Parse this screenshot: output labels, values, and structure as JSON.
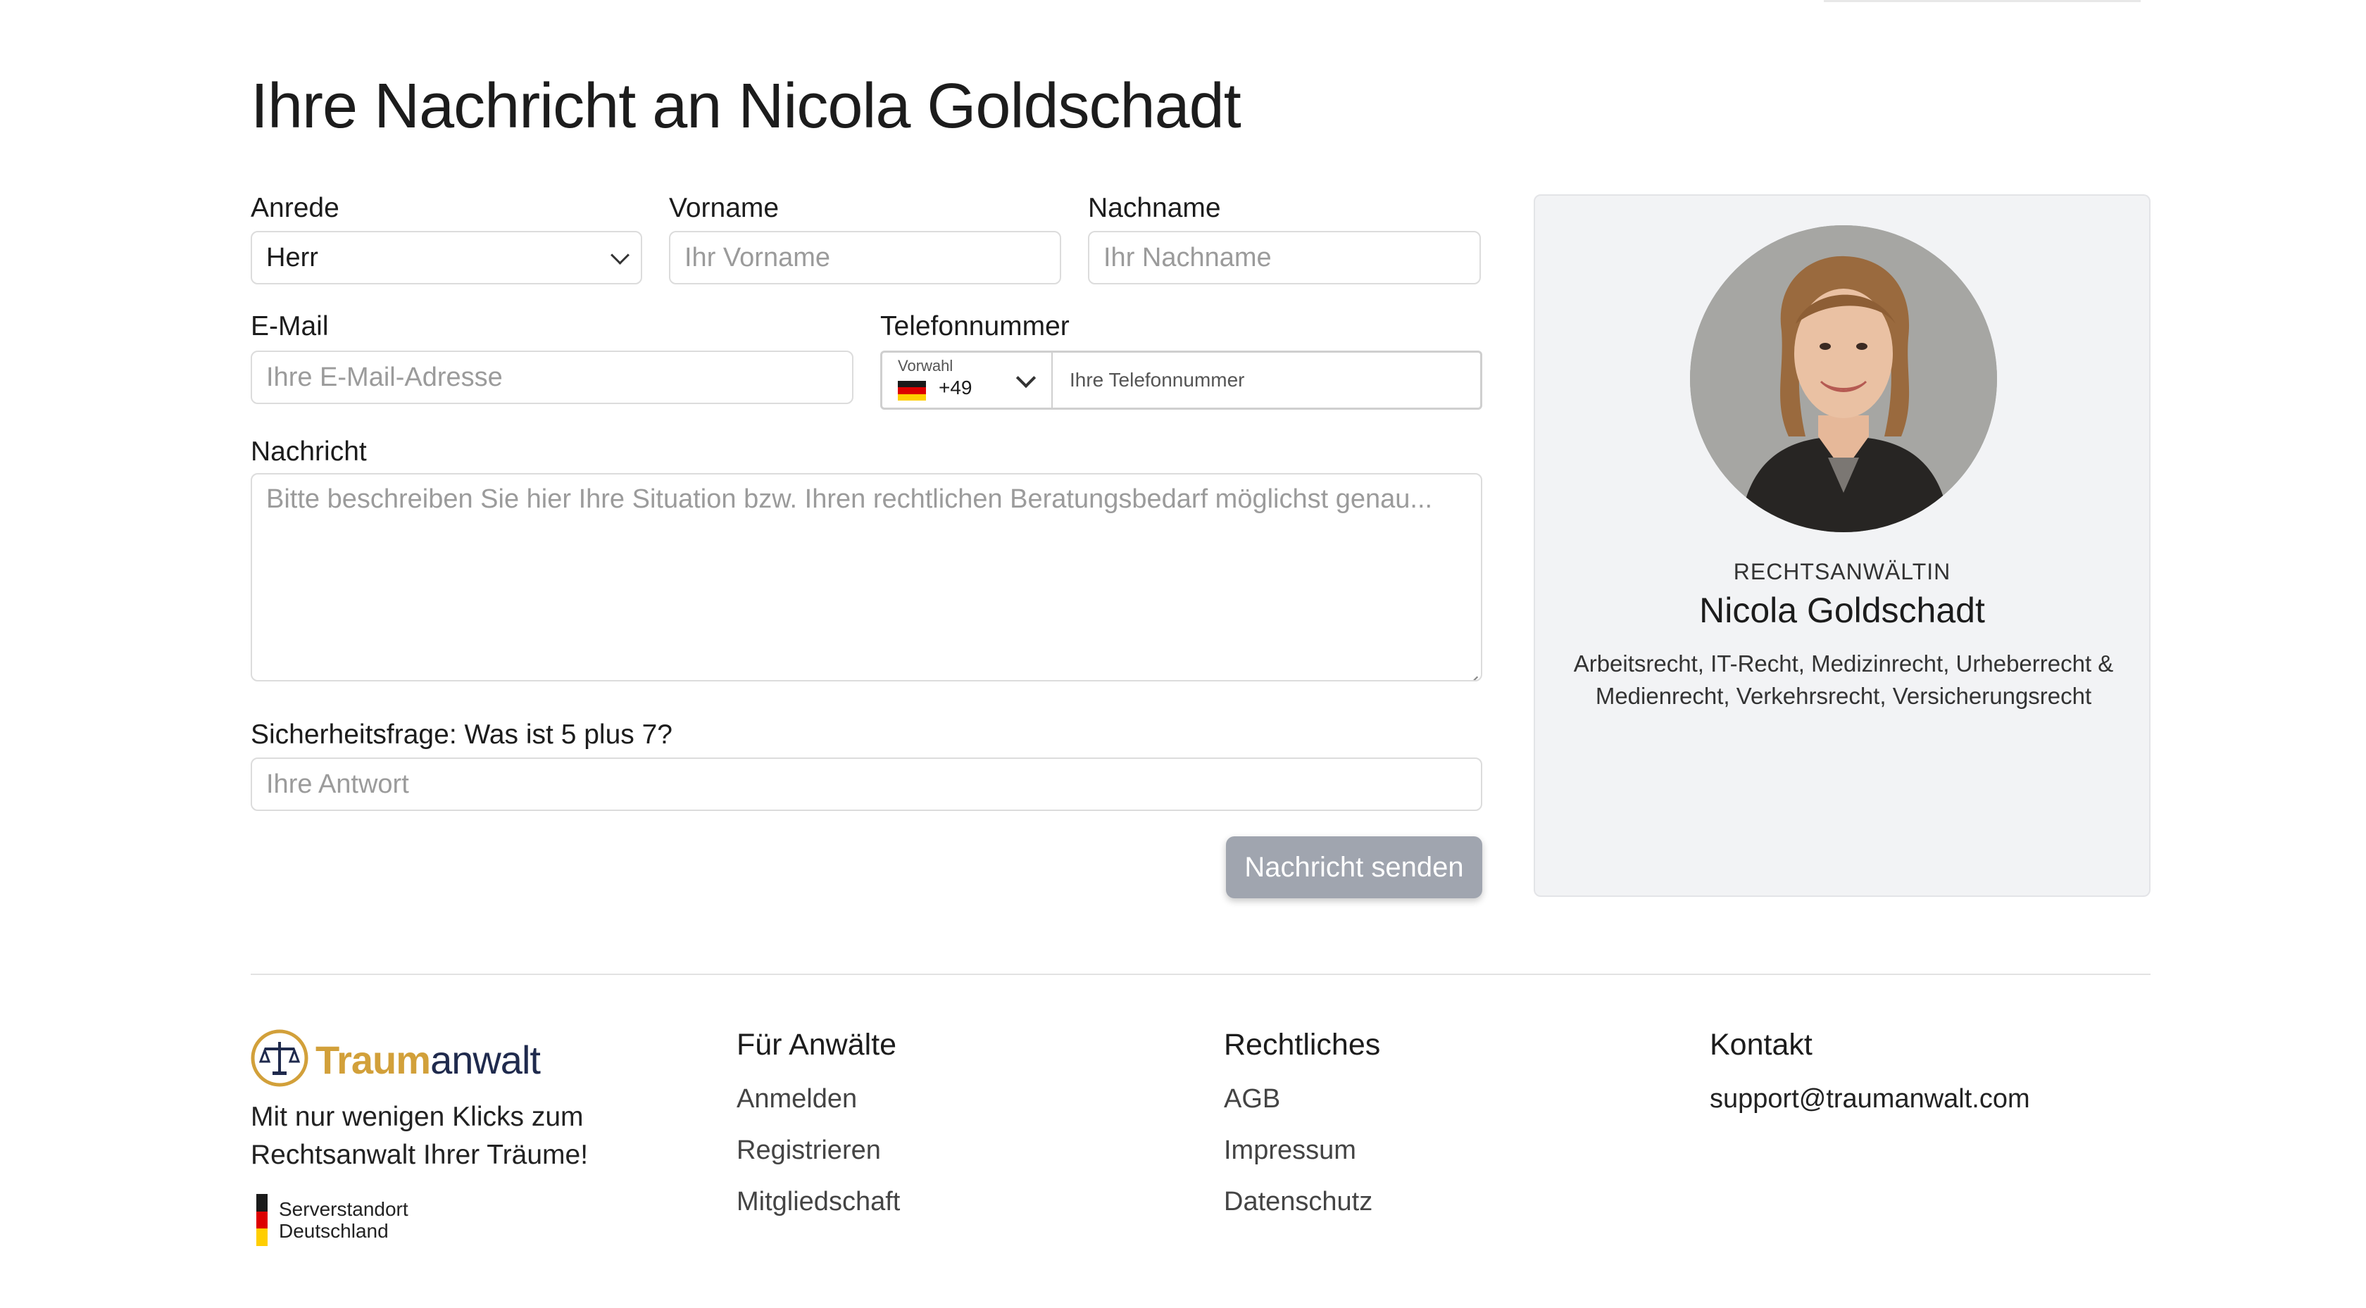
{
  "page": {
    "title": "Ihre Nachricht an Nicola Goldschadt"
  },
  "form": {
    "anrede": {
      "label": "Anrede",
      "value": "Herr"
    },
    "vorname": {
      "label": "Vorname",
      "placeholder": "Ihr Vorname"
    },
    "nachname": {
      "label": "Nachname",
      "placeholder": "Ihr Nachname"
    },
    "email": {
      "label": "E-Mail",
      "placeholder": "Ihre E-Mail-Adresse"
    },
    "telefon": {
      "label": "Telefonnummer",
      "prefix_label": "Vorwahl",
      "prefix_code": "+49",
      "placeholder": "Ihre Telefonnummer"
    },
    "nachricht": {
      "label": "Nachricht",
      "placeholder": "Bitte beschreiben Sie hier Ihre Situation bzw. Ihren rechtlichen Beratungsbedarf möglichst genau..."
    },
    "sicherheitsfrage": {
      "label": "Sicherheitsfrage: Was ist 5 plus 7?",
      "placeholder": "Ihre Antwort"
    },
    "submit_label": "Nachricht senden"
  },
  "lawyer": {
    "role": "RECHTSANWÄLTIN",
    "name": "Nicola Goldschadt",
    "areas": "Arbeitsrecht, IT-Recht, Medizinrecht, Urheberrecht & Medienrecht, Verkehrsrecht, Versicherungsrecht"
  },
  "footer": {
    "brand": {
      "part1": "Traum",
      "part2": "anwalt"
    },
    "tagline": "Mit nur wenigen Klicks zum Rechtsanwalt Ihrer Träume!",
    "server": {
      "line1": "Serverstandort",
      "line2": "Deutschland"
    },
    "columns": [
      {
        "title": "Für Anwälte",
        "links": [
          "Anmelden",
          "Registrieren",
          "Mitgliedschaft"
        ]
      },
      {
        "title": "Rechtliches",
        "links": [
          "AGB",
          "Impressum",
          "Datenschutz"
        ]
      },
      {
        "title": "Kontakt",
        "links": [
          "support@traumanwalt.com"
        ]
      }
    ]
  },
  "colors": {
    "brand_gold": "#d2a03a",
    "brand_navy": "#1f2a4d",
    "button_disabled": "#a0a5af",
    "card_background": "#f2f3f5"
  }
}
